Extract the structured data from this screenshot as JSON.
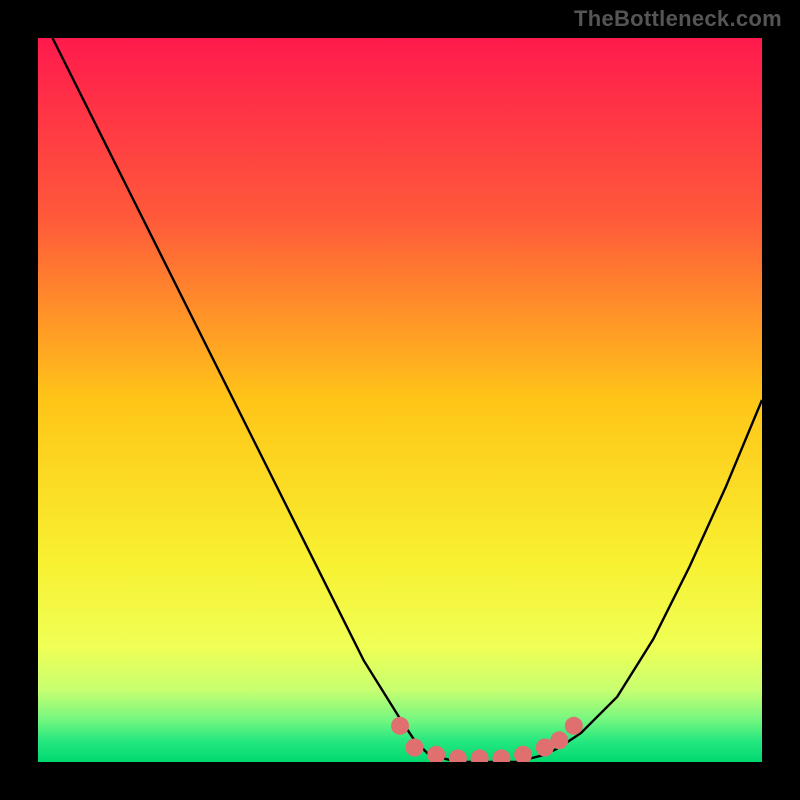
{
  "watermark": "TheBottleneck.com",
  "chart_data": {
    "type": "line",
    "title": "",
    "xlabel": "",
    "ylabel": "",
    "xlim": [
      0,
      100
    ],
    "ylim": [
      0,
      100
    ],
    "grid": false,
    "series": [
      {
        "name": "curve",
        "color": "#000000",
        "x": [
          2,
          5,
          10,
          15,
          20,
          25,
          30,
          35,
          40,
          45,
          50,
          52,
          54,
          58,
          62,
          66,
          70,
          72,
          75,
          80,
          85,
          90,
          95,
          100
        ],
        "y": [
          100,
          94,
          84,
          74,
          64,
          54,
          44,
          34,
          24,
          14,
          6,
          3,
          1,
          0,
          0,
          0,
          1,
          2,
          4,
          9,
          17,
          27,
          38,
          50
        ]
      },
      {
        "name": "dots",
        "color": "#e07070",
        "style": "marker",
        "x": [
          50,
          52,
          55,
          58,
          61,
          64,
          67,
          70,
          72,
          74
        ],
        "y": [
          5,
          2,
          1,
          0.5,
          0.5,
          0.5,
          1,
          2,
          3,
          5
        ]
      }
    ],
    "gradient_stops": [
      {
        "offset": 0.0,
        "color": "#ff1a4d"
      },
      {
        "offset": 0.25,
        "color": "#ff5a3a"
      },
      {
        "offset": 0.5,
        "color": "#ffc518"
      },
      {
        "offset": 0.72,
        "color": "#f8f030"
      },
      {
        "offset": 0.84,
        "color": "#f0ff55"
      },
      {
        "offset": 0.9,
        "color": "#c8ff70"
      },
      {
        "offset": 0.94,
        "color": "#78f780"
      },
      {
        "offset": 0.97,
        "color": "#28e880"
      },
      {
        "offset": 1.0,
        "color": "#00d870"
      }
    ]
  }
}
